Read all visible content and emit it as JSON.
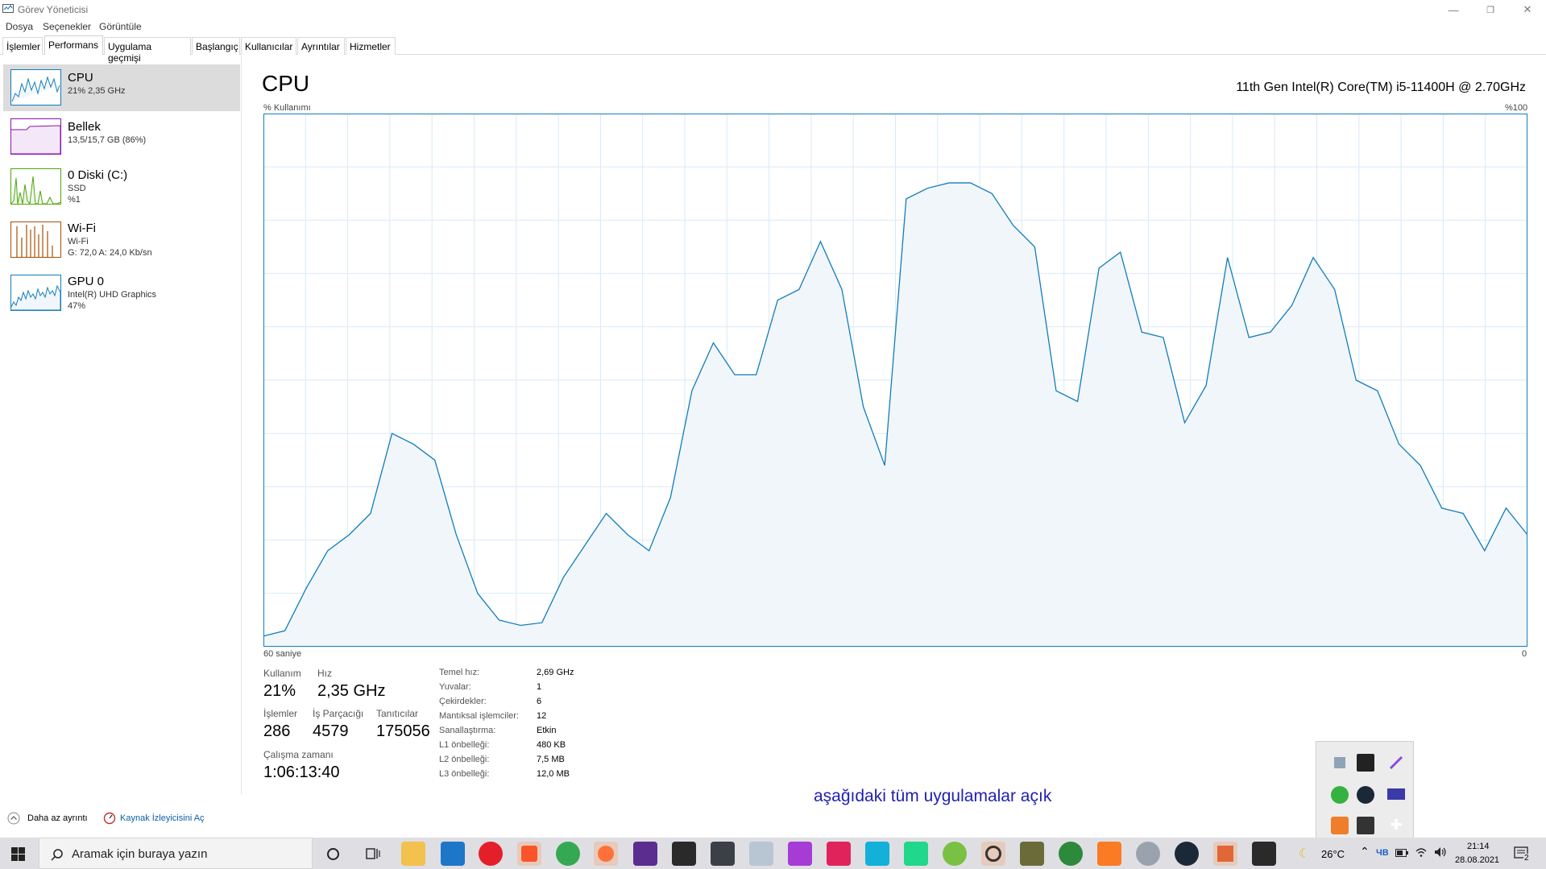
{
  "window": {
    "title": "Görev Yöneticisi",
    "minimize": "—",
    "restore": "❐",
    "close": "✕"
  },
  "menu": [
    "Dosya",
    "Seçenekler",
    "Görüntüle"
  ],
  "tabs": [
    "İşlemler",
    "Performans",
    "Uygulama geçmişi",
    "Başlangıç",
    "Kullanıcılar",
    "Ayrıntılar",
    "Hizmetler"
  ],
  "active_tab": "Performans",
  "sidebar": {
    "items": [
      {
        "name": "CPU",
        "sub1": "21% 2,35 GHz",
        "sub2": "",
        "sub3": "",
        "color": "#117dbb"
      },
      {
        "name": "Bellek",
        "sub1": "13,5/15,7 GB (86%)",
        "sub2": "",
        "sub3": "",
        "color": "#8b12ae"
      },
      {
        "name": "0 Diski (C:)",
        "sub1": "SSD",
        "sub2": "%1",
        "sub3": "",
        "color": "#4da60c"
      },
      {
        "name": "Wi-Fi",
        "sub1": "Wi-Fi",
        "sub2": "G: 72,0 A: 24,0 Kb/sn",
        "sub3": "",
        "color": "#a74f01"
      },
      {
        "name": "GPU 0",
        "sub1": "Intel(R) UHD Graphics",
        "sub2": "47%",
        "sub3": "",
        "color": "#117dbb"
      }
    ]
  },
  "main": {
    "title": "CPU",
    "model": "11th Gen Intel(R) Core(TM) i5-11400H @ 2.70GHz",
    "y_label": "% Kullanımı",
    "y_max_label": "%100",
    "x_left_label": "60 saniye",
    "x_right_label": "0"
  },
  "chart_data": {
    "type": "area",
    "ylim": [
      0,
      100
    ],
    "values": [
      2,
      3,
      11,
      18,
      21,
      25,
      40,
      38,
      35,
      21,
      10,
      5,
      4,
      4.5,
      13,
      19,
      25,
      21,
      18,
      28,
      48,
      57,
      51,
      51,
      65,
      67,
      76,
      67,
      45,
      34,
      84,
      86,
      87,
      87,
      85,
      79,
      75,
      48,
      46,
      71,
      74,
      59,
      58,
      42,
      49,
      73,
      58,
      59,
      64,
      73,
      67,
      50,
      48,
      38,
      34,
      26,
      25,
      18,
      26,
      21
    ]
  },
  "stats": {
    "usage_label": "Kullanım",
    "usage_value": "21%",
    "speed_label": "Hız",
    "speed_value": "2,35 GHz",
    "proc_label": "İşlemler",
    "proc_value": "286",
    "threads_label": "İş Parçacığı",
    "threads_value": "4579",
    "handles_label": "Tanıtıcılar",
    "handles_value": "175056",
    "uptime_label": "Çalışma zamanı",
    "uptime_value": "1:06:13:40"
  },
  "details": [
    {
      "label": "Temel hız:",
      "value": "2,69 GHz"
    },
    {
      "label": "Yuvalar:",
      "value": "1"
    },
    {
      "label": "Çekirdekler:",
      "value": "6"
    },
    {
      "label": "Mantıksal işlemciler:",
      "value": "12"
    },
    {
      "label": "Sanallaştırma:",
      "value": "Etkin"
    },
    {
      "label": "L1 önbelleği:",
      "value": "480 KB"
    },
    {
      "label": "L2 önbelleği:",
      "value": "7,5 MB"
    },
    {
      "label": "L3 önbelleği:",
      "value": "12,0 MB"
    }
  ],
  "footer": {
    "fewer_details": "Daha az ayrıntı",
    "resource_monitor": "Kaynak İzleyicisini Aç"
  },
  "note": "aşağıdaki tüm uygulamalar açık",
  "taskbar": {
    "search_placeholder": "Aramak için buraya yazın",
    "weather": "26°C",
    "time": "21:14",
    "date": "28.08.2021",
    "notifications": "2",
    "keyboard_lang": "ЧВ"
  }
}
